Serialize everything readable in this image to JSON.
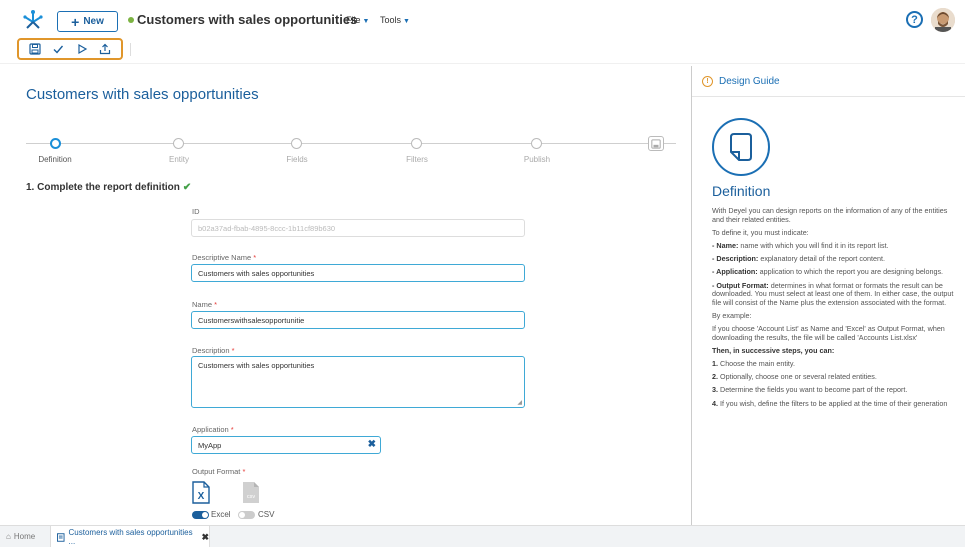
{
  "header": {
    "new_label": "New",
    "document_title": "Customers with sales opportunities",
    "status_color": "#7cb342",
    "menus": [
      {
        "label": "File"
      },
      {
        "label": "Tools"
      }
    ],
    "help_label": "?"
  },
  "toolbar": {
    "icons": [
      "save-icon",
      "check-icon",
      "play-icon",
      "publish-icon"
    ]
  },
  "main": {
    "title": "Customers with sales opportunities",
    "steps": [
      {
        "label": "Definition",
        "active": true
      },
      {
        "label": "Entity",
        "active": false
      },
      {
        "label": "Fields",
        "active": false
      },
      {
        "label": "Filters",
        "active": false
      },
      {
        "label": "Publish",
        "active": false
      }
    ],
    "section_heading": "1. Complete the report definition",
    "form": {
      "id_label": "ID",
      "id_value": "b02a37ad-fbab-4895-8ccc-1b11cf89b630",
      "descriptive_name_label": "Descriptive Name",
      "descriptive_name_value": "Customers with sales opportunities",
      "name_label": "Name",
      "name_value": "Customerswithsalesopportunitie",
      "description_label": "Description",
      "description_value": "Customers with sales opportunities",
      "application_label": "Application",
      "application_value": "MyApp",
      "output_format_label": "Output Format",
      "required_mark": "*",
      "formats": [
        {
          "label": "Excel",
          "enabled": true
        },
        {
          "label": "CSV",
          "enabled": false
        }
      ],
      "csv_icon_text": "csv"
    }
  },
  "design_guide": {
    "header": "Design Guide",
    "title": "Definition",
    "paragraphs": [
      {
        "bold": "",
        "text": "With Deyel you can design reports on the information of any of the entities and their related entities."
      },
      {
        "bold": "",
        "text": "To define it, you must indicate:"
      },
      {
        "bold": "- Name:",
        "text": " name with which you will find it in its report list."
      },
      {
        "bold": "- Description:",
        "text": " explanatory detail of the report content."
      },
      {
        "bold": "- Application:",
        "text": " application to which the report you are designing belongs."
      },
      {
        "bold": "- Output Format:",
        "text": " determines in what format or formats the result can be downloaded. You must select at least one of them. In either case, the output file will consist of the Name plus the extension associated with the format."
      },
      {
        "bold": "",
        "text": "By example:"
      },
      {
        "bold": "",
        "text": "If you choose 'Account List' as Name and 'Excel' as Output Format, when downloading the results, the file will be called 'Accounts List.xlsx'"
      },
      {
        "bold": "Then, in successive steps, you can:",
        "text": ""
      },
      {
        "bold": "1.",
        "text": " Choose the main entity."
      },
      {
        "bold": "2.",
        "text": " Optionally, choose one or several related entities."
      },
      {
        "bold": "3.",
        "text": " Determine the fields you want to become part of the report."
      },
      {
        "bold": "4.",
        "text": " If you wish, define the filters to be applied at the time of their generation"
      }
    ]
  },
  "bottom_tabs": {
    "home": "Home",
    "document": "Customers with sales opportunities ..."
  },
  "colors": {
    "accent": "#1b6fb4",
    "highlight": "#e0962b",
    "success": "#43a047"
  }
}
